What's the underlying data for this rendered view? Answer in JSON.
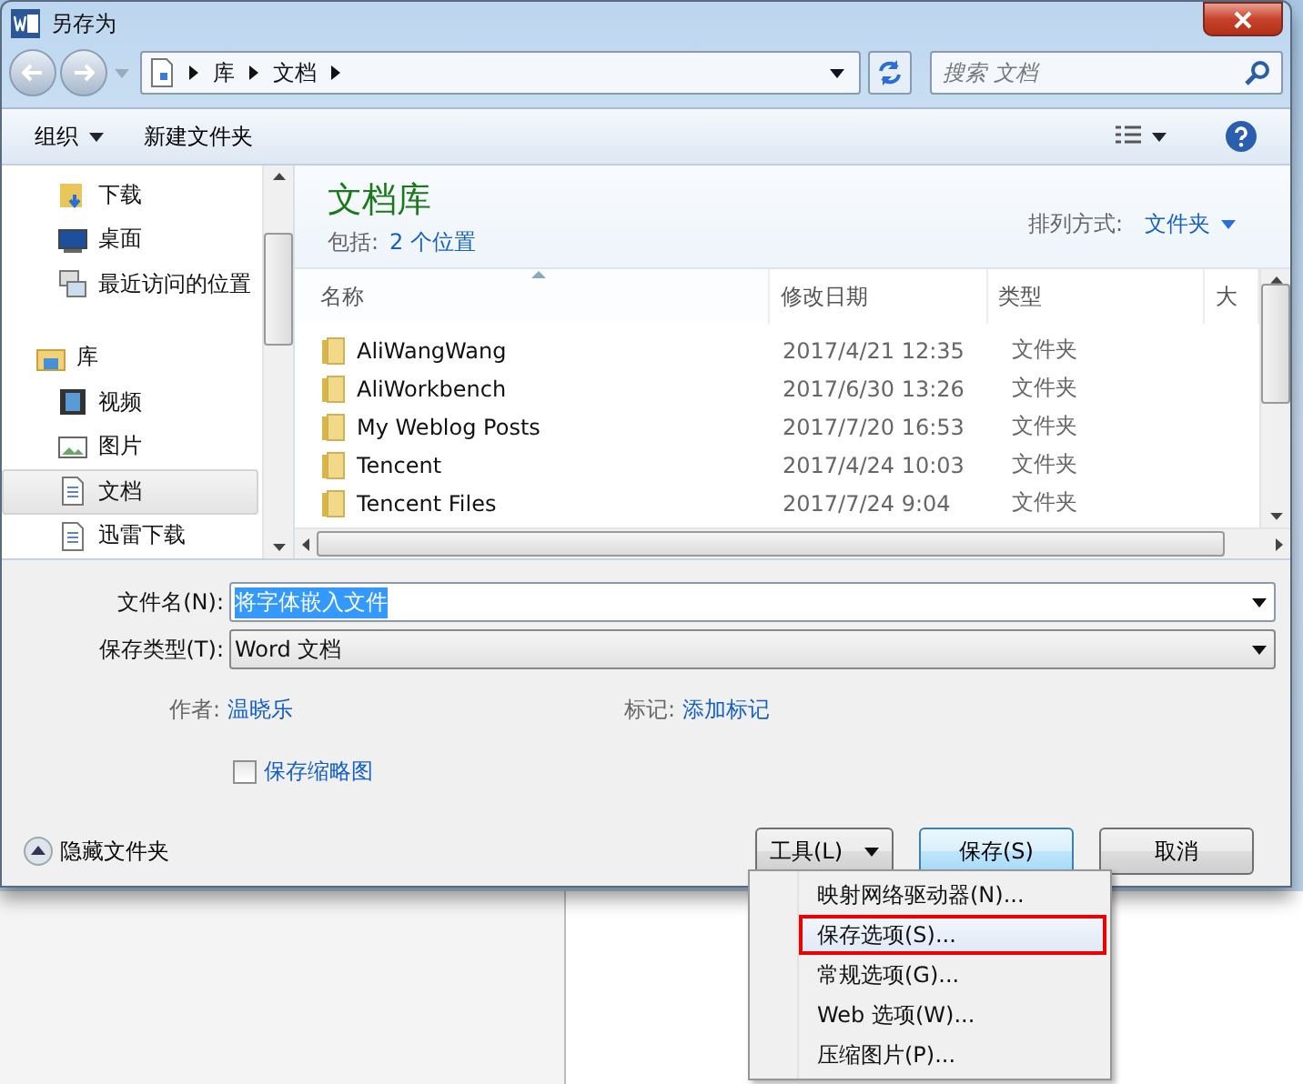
{
  "window": {
    "title": "另存为"
  },
  "address": {
    "breadcrumbs": [
      "库",
      "文档"
    ]
  },
  "search": {
    "placeholder": "搜索 文档"
  },
  "toolbar": {
    "organize": "组织",
    "new_folder": "新建文件夹"
  },
  "sidebar": {
    "favorites": [
      {
        "label": "下载",
        "kind": "download",
        "selected": false
      },
      {
        "label": "桌面",
        "kind": "desktop",
        "selected": false
      },
      {
        "label": "最近访问的位置",
        "kind": "recent",
        "selected": false
      }
    ],
    "libraries": {
      "label": "库",
      "kind": "library",
      "selected": false,
      "children": [
        {
          "label": "视频",
          "kind": "video",
          "selected": false
        },
        {
          "label": "图片",
          "kind": "picture",
          "selected": false
        },
        {
          "label": "文档",
          "kind": "document",
          "selected": true
        },
        {
          "label": "迅雷下载",
          "kind": "document",
          "selected": false
        }
      ]
    }
  },
  "library": {
    "title": "文档库",
    "includes_label": "包括:",
    "includes_link": "2 个位置",
    "arrange_label": "排列方式:",
    "arrange_value": "文件夹"
  },
  "table": {
    "columns": [
      {
        "label": "名称",
        "sorted": true
      },
      {
        "label": "修改日期",
        "sorted": false
      },
      {
        "label": "类型",
        "sorted": false
      },
      {
        "label": "大",
        "sorted": false
      }
    ],
    "rows": [
      {
        "name": "AliWangWang",
        "modified": "2017/4/21 12:35",
        "type": "文件夹"
      },
      {
        "name": "AliWorkbench",
        "modified": "2017/6/30 13:26",
        "type": "文件夹"
      },
      {
        "name": "My Weblog Posts",
        "modified": "2017/7/20 16:53",
        "type": "文件夹"
      },
      {
        "name": "Tencent",
        "modified": "2017/4/24 10:03",
        "type": "文件夹"
      },
      {
        "name": "Tencent Files",
        "modified": "2017/7/24 9:04",
        "type": "文件夹"
      }
    ]
  },
  "form": {
    "filename_label": "文件名(N):",
    "filename": "将字体嵌入文件",
    "filename_selected": true,
    "type_label": "保存类型(T):",
    "type": "Word 文档",
    "author_label": "作者:",
    "author": "温晓乐",
    "tags_label": "标记:",
    "tags": "添加标记",
    "thumbnail": {
      "label": "保存缩略图",
      "checked": false
    }
  },
  "footer": {
    "hide_folders": "隐藏文件夹",
    "buttons": [
      {
        "label": "工具(L)",
        "kind": "menu"
      },
      {
        "label": "保存(S)",
        "kind": "default"
      },
      {
        "label": "取消",
        "kind": "normal"
      }
    ]
  },
  "menu": {
    "items": [
      {
        "label": "映射网络驱动器(N)...",
        "selected": false
      },
      {
        "label": "保存选项(S)...",
        "selected": true
      },
      {
        "label": "常规选项(G)...",
        "selected": false
      },
      {
        "label": "Web 选项(W)...",
        "selected": false
      },
      {
        "label": "压缩图片(P)...",
        "selected": false
      }
    ]
  }
}
